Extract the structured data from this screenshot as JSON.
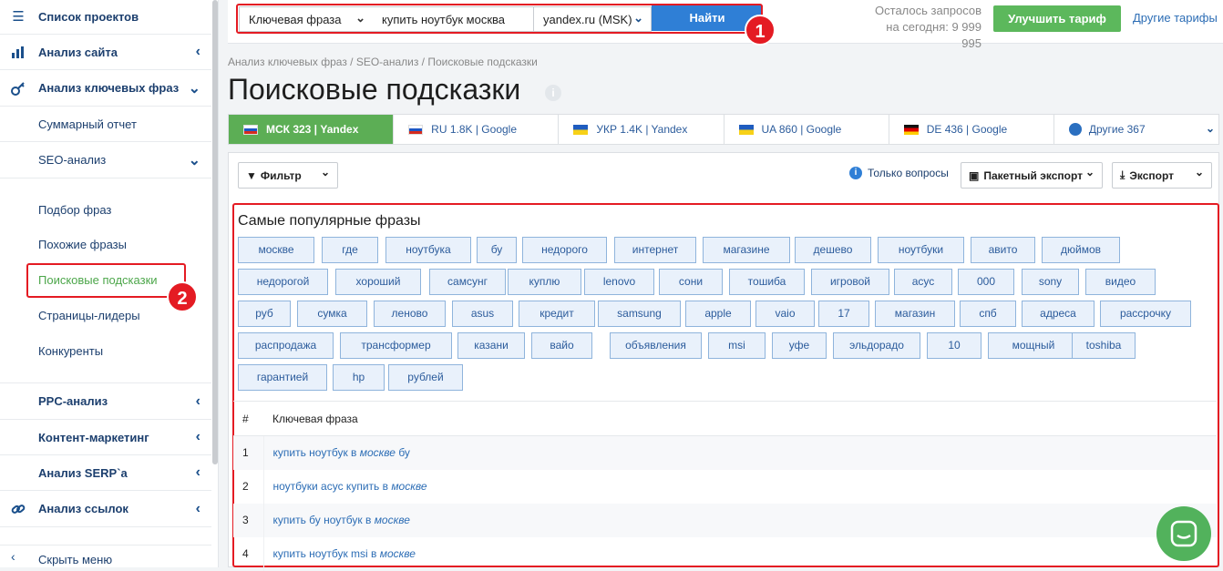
{
  "sidebar": {
    "items": [
      {
        "label": "Список проектов",
        "icon": "menu-icon"
      },
      {
        "label": "Анализ сайта",
        "icon": "chart-icon"
      },
      {
        "label": "Анализ ключевых фраз",
        "icon": "key-icon"
      },
      {
        "label": "Суммарный отчет"
      },
      {
        "label": "SEO-анализ"
      },
      {
        "label": "Подбор фраз"
      },
      {
        "label": "Похожие фразы"
      },
      {
        "label": "Поисковые подсказки",
        "active": true
      },
      {
        "label": "Страницы-лидеры"
      },
      {
        "label": "Конкуренты"
      },
      {
        "label": "PPC-анализ"
      },
      {
        "label": "Контент-маркетинг"
      },
      {
        "label": "Анализ SERP`a"
      },
      {
        "label": "Анализ ссылок",
        "icon": "link-icon"
      }
    ],
    "hide_menu": "Скрыть меню"
  },
  "annotations": {
    "badge1": "1",
    "badge2": "2",
    "color": "#e41b23"
  },
  "topbar": {
    "type_select": "Ключевая фраза",
    "query_value": "купить ноутбук москва",
    "engine_select": "yandex.ru (MSK)",
    "find_button": "Найти",
    "quota_line1": "Осталось запросов",
    "quota_line2": "на сегодня: 9 999 995",
    "upgrade_button": "Улучшить тариф",
    "other_tariffs": "Другие тарифы"
  },
  "breadcrumb": "Анализ ключевых фраз / SEO-анализ / Поисковые подсказки",
  "page_title": "Поисковые подсказки",
  "region_tabs": [
    {
      "label": "МСК 323 | Yandex",
      "flag": "ru",
      "active": true
    },
    {
      "label": "RU 1.8K | Google",
      "flag": "ru"
    },
    {
      "label": "УКР 1.4K | Yandex",
      "flag": "ua"
    },
    {
      "label": "UA 860 | Google",
      "flag": "ua"
    },
    {
      "label": "DE 436 | Google",
      "flag": "de"
    },
    {
      "label": "Другие 367",
      "flag": "globe"
    }
  ],
  "toolbar": {
    "filter": "Фильтр",
    "only_questions": "Только вопросы",
    "batch_export": "Пакетный экспорт",
    "export": "Экспорт"
  },
  "popular": {
    "title": "Самые популярные фразы",
    "chips": [
      "москве",
      "где",
      "ноутбука",
      "бу",
      "недорого",
      "интернет",
      "магазине",
      "дешево",
      "ноутбуки",
      "авито",
      "дюймов",
      "недорогой",
      "хороший",
      "самсунг",
      "куплю",
      "lenovo",
      "сони",
      "тошиба",
      "игровой",
      "асус",
      "000",
      "sony",
      "видео",
      "руб",
      "сумка",
      "леново",
      "asus",
      "кредит",
      "samsung",
      "apple",
      "vaio",
      "17",
      "магазин",
      "спб",
      "адреса",
      "рассрочку",
      "распродажа",
      "трансформер",
      "казани",
      "вайо",
      "объявления",
      "msi",
      "уфе",
      "эльдорадо",
      "10",
      "мощный",
      "toshiba",
      "гарантией",
      "hp",
      "рублей"
    ]
  },
  "table": {
    "headers": [
      "#",
      "Ключевая фраза"
    ],
    "rows": [
      {
        "num": "1",
        "pre": "купить ноутбук в ",
        "em": "москве",
        "post": " бу"
      },
      {
        "num": "2",
        "pre": "ноутбуки асус купить в ",
        "em": "москве",
        "post": ""
      },
      {
        "num": "3",
        "pre": "купить бу ноутбук в ",
        "em": "москве",
        "post": ""
      },
      {
        "num": "4",
        "pre": "купить ноутбук msi в ",
        "em": "москве",
        "post": ""
      }
    ]
  },
  "colors": {
    "accent": "#2f7fd6",
    "green": "#5cae55",
    "link": "#2c6db5"
  }
}
